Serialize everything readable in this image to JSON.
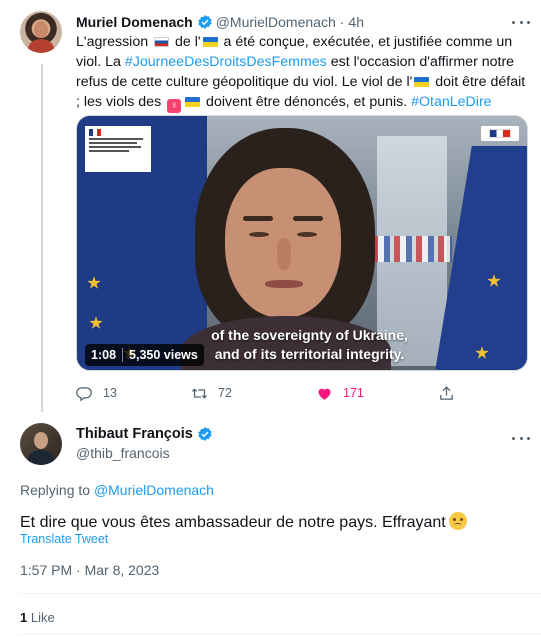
{
  "parent_tweet": {
    "display_name": "Muriel Domenach",
    "handle": "@MurielDomenach",
    "time": "4h",
    "text": {
      "p1": "L'agression ",
      "p2": " de l'",
      "p3": " a été conçue, exécutée, et justifiée comme un viol. La ",
      "hashtag1": "#JourneeDesDroitsDesFemmes",
      "p4": " est l'occasion d'affirmer notre refus de cette culture géopolitique du viol. Le viol de l'",
      "p5": " doit être défait ; les viols des ",
      "p6": " doivent être dénoncés, et punis. ",
      "hashtag2": "#OtanLeDire"
    },
    "video": {
      "caption_line1": "of the sovereignty of Ukraine,",
      "caption_line2": "and of its territorial integrity.",
      "duration": "1:08",
      "views": "5,350 views"
    },
    "actions": {
      "replies": "13",
      "retweets": "72",
      "likes": "171"
    }
  },
  "reply_tweet": {
    "display_name": "Thibaut François",
    "handle": "@thib_francois",
    "replying_prefix": "Replying to",
    "replying_to": "@MurielDomenach",
    "text": "Et dire que vous êtes ambassadeur de notre pays. Effrayant",
    "translate": "Translate Tweet",
    "timestamp": "1:57 PM · Mar 8, 2023",
    "likes_count": "1",
    "likes_label": "Like"
  },
  "colors": {
    "accent": "#1d9bf0",
    "like": "#f91880",
    "secondary_text": "#536471"
  }
}
